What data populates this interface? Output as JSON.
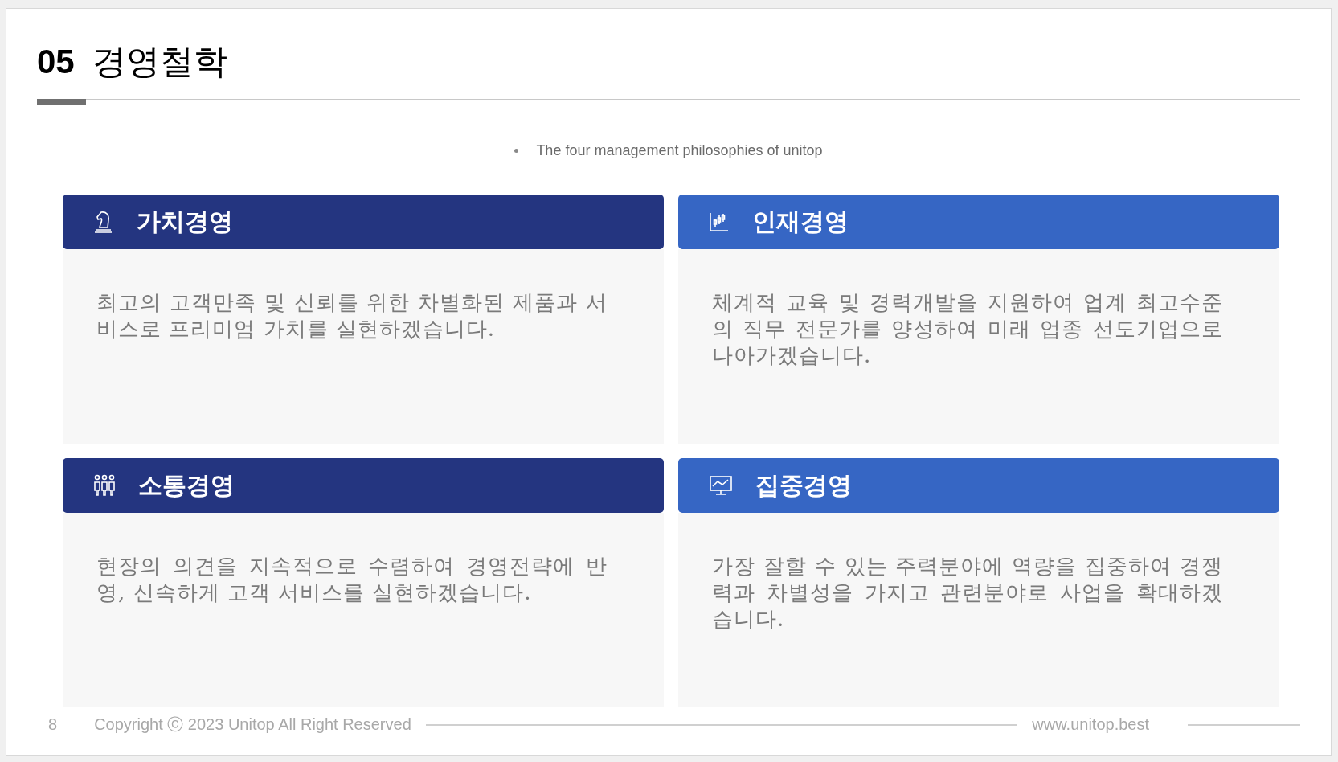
{
  "title": {
    "number": "05",
    "text": "경영철학"
  },
  "subtitle": "The four management philosophies of unitop",
  "cards": [
    {
      "title": "가치경영",
      "color": "#243580",
      "body": "최고의 고객만족 및 신뢰를 위한 차별화된 제품과 서비스로 프리미엄 가치를 실현하겠습니다."
    },
    {
      "title": "인재경영",
      "color": "#3666c4",
      "body": "체계적 교육 및 경력개발을 지원하여 업계 최고수준의 직무 전문가를 양성하여 미래 업종 선도기업으로 나아가겠습니다."
    },
    {
      "title": "소통경영",
      "color": "#243580",
      "body": "현장의 의견을 지속적으로 수렴하여 경영전략에 반영, 신속하게 고객 서비스를 실현하겠습니다."
    },
    {
      "title": "집중경영",
      "color": "#3666c4",
      "body": "가장 잘할 수 있는 주력분야에 역량을 집중하여 경쟁력과 차별성을 가지고 관련분야로 사업을 확대하겠습니다."
    }
  ],
  "footer": {
    "page": "8",
    "copyright": "Copyright ⓒ 2023 Unitop All Right Reserved",
    "website": "www.unitop.best"
  }
}
